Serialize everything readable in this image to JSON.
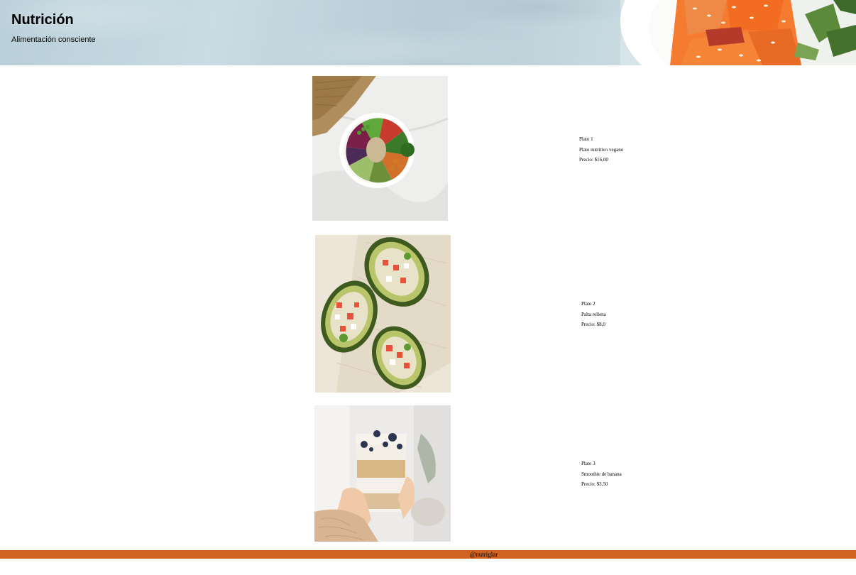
{
  "header": {
    "title": "Nutrición",
    "subtitle": "Alimentación consciente"
  },
  "products": [
    {
      "name": "Plato 1",
      "description": "Plato nutritivo vegano",
      "price": "Precio: $16,00",
      "image": "vegan-bowl-image"
    },
    {
      "name": "Plato 2",
      "description": "Palta rellena",
      "price": "Precio: $8,0",
      "image": "stuffed-avocado-image"
    },
    {
      "name": "Plato 3",
      "description": "Smoothie de banana",
      "price": "Precio: $3,50",
      "image": "banana-smoothie-image"
    }
  ],
  "footer": {
    "handle": "@nutriglar",
    "color": "#cf6420"
  },
  "colors": {
    "header_bg": "#c2d6df",
    "salmon": "#f07a32"
  }
}
